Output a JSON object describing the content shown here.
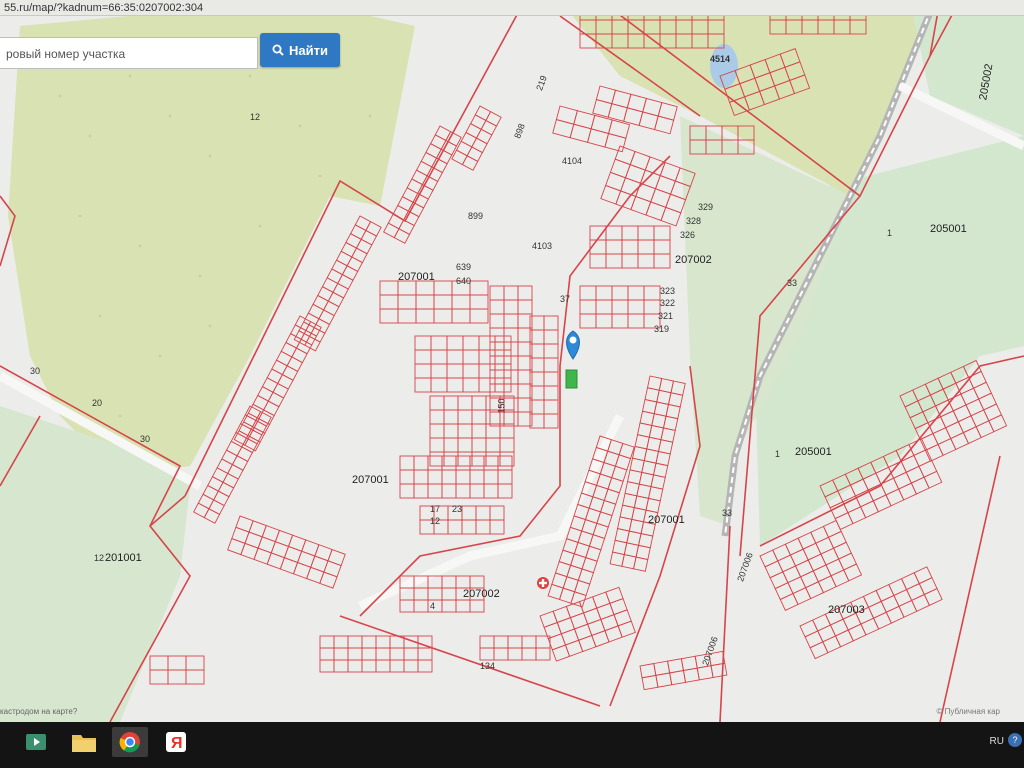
{
  "browser": {
    "url": "55.ru/map/?kadnum=66:35:0207002:304"
  },
  "search": {
    "placeholder": "ровый номер участка",
    "button_label": "Найти"
  },
  "map": {
    "block_labels": {
      "b207001_a": "207001",
      "b207001_b": "207001",
      "b207002_a": "207002",
      "b207002_b": "207002",
      "b207003": "207003",
      "b207001_c": "207001",
      "b205001_a": "205001",
      "b205001_b": "205001",
      "b201001": "201001",
      "b205002": "205002",
      "b207006": "207006",
      "b207006b": "207006"
    },
    "parcel_labels": {
      "p12": "12",
      "p30a": "30",
      "p30b": "30",
      "p20": "20",
      "p4514": "4514",
      "p219": "219",
      "p898": "898",
      "p4104": "4104",
      "p899": "899",
      "p4103": "4103",
      "p639": "639",
      "p640": "640",
      "p37": "37",
      "p329": "329",
      "p328": "328",
      "p326": "326",
      "p323": "323",
      "p322": "322",
      "p321": "321",
      "p319": "319",
      "p33a": "33",
      "p33b": "33",
      "p1a": "1",
      "p1b": "1",
      "p12b": "12",
      "p150": "150",
      "p17": "17",
      "p12c": "12",
      "p23": "23",
      "p4": "4",
      "p134": "134"
    },
    "attribution": "© Публичная кар",
    "bottom_text": "кастродом на карте?"
  },
  "colors": {
    "boundary": "#d6454a",
    "forest": "#d9e4b4",
    "green": "#cfe4c9",
    "background": "#ededea",
    "marker": "#2c8ad8",
    "selected": "#3fb54a"
  },
  "taskbar": {
    "lang": "RU",
    "items": [
      "media-player-icon",
      "file-manager-icon",
      "chrome-icon",
      "yandex-icon"
    ]
  }
}
